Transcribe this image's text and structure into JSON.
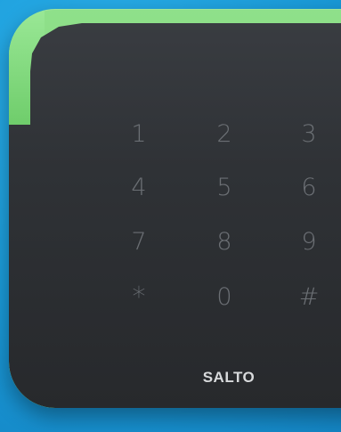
{
  "keypad": {
    "rows": [
      [
        "1",
        "2",
        "3"
      ],
      [
        "4",
        "5",
        "6"
      ],
      [
        "7",
        "8",
        "9"
      ],
      [
        "*",
        "0",
        "#"
      ]
    ]
  },
  "brand": "SALTO",
  "colors": {
    "background": "#1a9ad8",
    "panel": "#2f3236",
    "led_ring": "#8fe08a",
    "key_text": "#6b6f74",
    "brand_text": "#d8dadc"
  }
}
